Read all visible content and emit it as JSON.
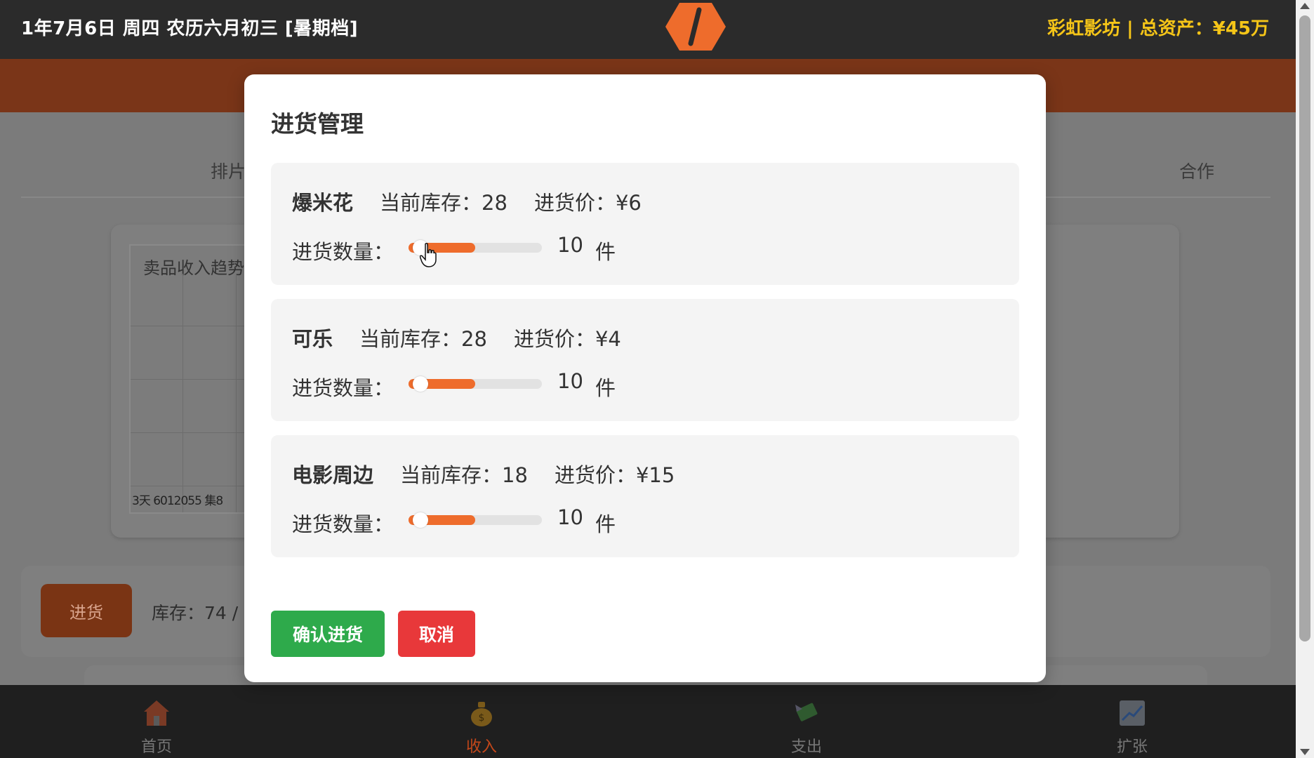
{
  "header": {
    "date_text": "1年7月6日 周四 农历六月初三 [暑期档]",
    "brand_text": "彩虹影坊 | 总资产：¥45万"
  },
  "background": {
    "tab_left": "排片",
    "tab_right": "合作",
    "chart_title": "卖品收入趋势",
    "chart_ticks": "3天 6012055 集8",
    "restock_button": "进货",
    "stock_text": "库存：74 /"
  },
  "modal": {
    "title": "进货管理",
    "qty_label": "进货数量：",
    "stock_label": "当前库存：",
    "price_label": "进货价：",
    "unit": "件",
    "items": [
      {
        "name": "爆米花",
        "stock": "28",
        "price": "¥6",
        "qty": "10",
        "fill": 0.5
      },
      {
        "name": "可乐",
        "stock": "28",
        "price": "¥4",
        "qty": "10",
        "fill": 0.5
      },
      {
        "name": "电影周边",
        "stock": "18",
        "price": "¥15",
        "qty": "10",
        "fill": 0.5
      }
    ],
    "confirm_label": "确认进货",
    "cancel_label": "取消"
  },
  "nav": {
    "items": [
      {
        "label": "首页",
        "icon": "house-icon"
      },
      {
        "label": "收入",
        "icon": "money-bag-icon",
        "active": true
      },
      {
        "label": "支出",
        "icon": "money-wings-icon"
      },
      {
        "label": "扩张",
        "icon": "chart-increasing-icon"
      }
    ]
  },
  "colors": {
    "accent": "#ee6c2c",
    "brand_gold": "#f5c518",
    "confirm_green": "#2eaa4b",
    "cancel_red": "#e8383a",
    "nav_active": "#c3471a"
  }
}
